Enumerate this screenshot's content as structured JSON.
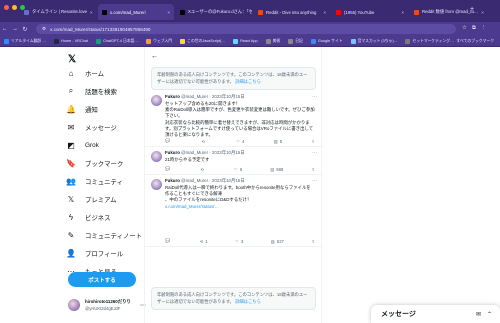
{
  "browser": {
    "tabs": [
      {
        "label": "タイムライン | Resonite.love",
        "color": "#6b6bd6",
        "active": false
      },
      {
        "label": "x.com/mad_Mureri",
        "color": "#000000",
        "active": true
      },
      {
        "label": "Xユーザーの@Fukuro.dさん：「セ…",
        "color": "#000000",
        "active": false
      },
      {
        "label": "Reddit - Dive into anything",
        "color": "#ff4500",
        "active": false
      },
      {
        "label": "(1955) YouTube",
        "color": "#ff0000",
        "active": false
      },
      {
        "label": "Reddit 数値 from @mad_tu…",
        "color": "#ff4500",
        "active": false
      }
    ],
    "url": "x.com/mad_Murer/status/1713381904857858490",
    "bookmarks": [
      {
        "label": "リアルタイム翻訳 …",
        "color": "#2d8cff"
      },
      {
        "label": "Home - VRChat",
        "color": "#1f2a44"
      },
      {
        "label": "ChatGPT-4 日本語…",
        "color": "#10a37f"
      },
      {
        "label": "ウェブ入門",
        "color": "#f0a030"
      },
      {
        "label": "この世のJavaScript(…",
        "color": "#f7df1e"
      },
      {
        "label": "React App",
        "color": "#61dafb"
      },
      {
        "label": "美術",
        "color": "#888888"
      },
      {
        "label": "日記",
        "color": "#888888"
      },
      {
        "label": "Google サイト",
        "color": "#4285f4"
      },
      {
        "label": "音マスカット (3ちゃ)…",
        "color": "#7cc4ff"
      },
      {
        "label": "セットマーケティング…",
        "color": "#7a7a7a"
      }
    ],
    "all_bookmarks": "すべてのブックマーク"
  },
  "nav": {
    "items": [
      {
        "name": "home",
        "label": "ホーム",
        "icon": "⌂"
      },
      {
        "name": "explore",
        "label": "話題を検索",
        "icon": "⌕"
      },
      {
        "name": "notifications",
        "label": "通知",
        "icon": "🔔"
      },
      {
        "name": "messages",
        "label": "メッセージ",
        "icon": "✉"
      },
      {
        "name": "grok",
        "label": "Grok",
        "icon": "◩"
      },
      {
        "name": "bookmarks",
        "label": "ブックマーク",
        "icon": "🔖"
      },
      {
        "name": "communities",
        "label": "コミュニティ",
        "icon": "👥"
      },
      {
        "name": "premium",
        "label": "プレミアム",
        "icon": "𝕏"
      },
      {
        "name": "business",
        "label": "ビジネス",
        "icon": "ϟ"
      },
      {
        "name": "community-notes",
        "label": "コミュニティノート",
        "icon": "✎"
      },
      {
        "name": "profile",
        "label": "プロフィール",
        "icon": "👤"
      },
      {
        "name": "more",
        "label": "もっと見る",
        "icon": "⋯"
      }
    ],
    "post_label": "ポストする",
    "account": {
      "name": "hirohiroto11260だりり",
      "handle": "@yHUKt2d4gEJdF"
    }
  },
  "main": {
    "notice_top": {
      "text": "年齢制限のある成人向けコンテンツです。このコンテンツは、18歳未満のユーザーには適切でない可能性があります。",
      "more": "詳細はこちら"
    },
    "notice_bottom": {
      "text": "年齢制限のある成人向けコンテンツです。このコンテンツは、18歳未満のユーザーには適切でない可能性があります。",
      "more": "詳細はこちら"
    },
    "tweets": [
      {
        "name": "Fukuro",
        "handle": "@mad_Murer · 2023年10月15日",
        "lines": [
          "セットアップ含めるも20に開きます！",
          "素のRaiDoll導入は簡単ですが、色変更や衣装変更は難しいです。ぜひご参加下さい。",
          "対応衣装なら比較的簡単に着せ替えできますが、非対応は時間がかかります。別プラットフォームですけ使っている場合はVRoファイルに書き出して頂けると楽になります。"
        ],
        "link": "",
        "replies": "",
        "reposts": "",
        "likes": "4",
        "views": "5"
      },
      {
        "name": "Fukuro",
        "handle": "@mad_Murer · 2023年10月15日",
        "lines": [
          "21時からやる予定です"
        ],
        "link": "",
        "replies": "",
        "reposts": "",
        "likes": "6",
        "views": "688"
      },
      {
        "name": "Fukuro",
        "handle": "@mad_Murer · 2023年10月15日",
        "lines": [
          "RaiDoll代導入は一瞬で終わります。booth中からresonite用ならファイルを作ることもすぐにできる解凍",
          "、中のファイルをresoniteにD&Dするだけ！"
        ],
        "link": "x.com/mad_Murer/status/…",
        "replies": "",
        "reposts": "1",
        "likes": "3",
        "views": "527"
      }
    ]
  },
  "drawer": {
    "title": "メッセージ"
  }
}
